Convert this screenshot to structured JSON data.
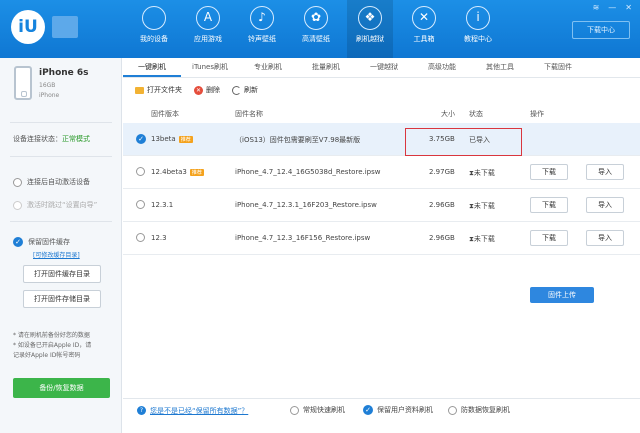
{
  "nav": {
    "items": [
      {
        "label": "我的设备",
        "icon": "apple-icon",
        "glyph": ""
      },
      {
        "label": "应用游戏",
        "icon": "app-store-icon",
        "glyph": "A"
      },
      {
        "label": "铃声壁纸",
        "icon": "bell-icon",
        "glyph": "♪"
      },
      {
        "label": "高清壁纸",
        "icon": "wallpaper-icon",
        "glyph": "✿"
      },
      {
        "label": "刷机越狱",
        "icon": "dropbox-icon",
        "glyph": "❖"
      },
      {
        "label": "工具箱",
        "icon": "toolbox-icon",
        "glyph": "✕"
      },
      {
        "label": "教程中心",
        "icon": "info-icon",
        "glyph": "i"
      }
    ],
    "active_index": 4,
    "download_label": "下载中心"
  },
  "device": {
    "name": "iPhone 6s",
    "capacity": "16GB",
    "model": "iPhone"
  },
  "sidebar": {
    "status_prefix": "设备连接状态：",
    "status_value": "正常模式",
    "option_auto_activate": "连接后自动激活设备",
    "option_skip_setup": "激活时跳过“设置向导”",
    "option_keep_files": "保留固件缓存",
    "link_change": "[可修改缓存目录]",
    "btn_open_cache": "打开固件缓存目录",
    "btn_open_store": "打开固件存储目录",
    "notice_lines": [
      "* 请在刷机前备份好您的数据",
      "* 如设备已开启Apple ID，请",
      "记录好Apple ID帐号密码"
    ],
    "backup_button": "备份/恢复数据"
  },
  "tabs": [
    "一键刷机",
    "iTunes刷机",
    "专业刷机",
    "批量刷机",
    "一键越狱",
    "高级功能",
    "其他工具",
    "下载固件"
  ],
  "toolbar": {
    "open_folder": "打开文件夹",
    "delete": "删除",
    "refresh": "刷新"
  },
  "table": {
    "headers": {
      "version": "固件版本",
      "name": "固件名称",
      "size": "大小",
      "status": "状态",
      "action": "操作"
    },
    "rows": [
      {
        "version": "13beta",
        "tag": "推荐",
        "name": "（iOS13）固件包需要刷至V7.98最新版",
        "size": "3.75GB",
        "status": "已导入",
        "download": "",
        "import": ""
      },
      {
        "version": "12.4beta3",
        "tag": "推荐",
        "name": "iPhone_4.7_12.4_16G5038d_Restore.ipsw",
        "size": "2.97GB",
        "status": "未下载",
        "download": "下载",
        "import": "导入"
      },
      {
        "version": "12.3.1",
        "tag": "",
        "name": "iPhone_4.7_12.3.1_16F203_Restore.ipsw",
        "size": "2.96GB",
        "status": "未下载",
        "download": "下载",
        "import": "导入"
      },
      {
        "version": "12.3",
        "tag": "",
        "name": "iPhone_4.7_12.3_16F156_Restore.ipsw",
        "size": "2.96GB",
        "status": "未下载",
        "download": "下载",
        "import": "导入"
      }
    ]
  },
  "upload_button": "固件上传",
  "bottom": {
    "help_link": "您是不是已经“保留所有数据”？",
    "opt_quick": "常规快速刷机",
    "opt_keep": "保留用户资料刷机",
    "opt_antiflash": "防数据恢复刷机"
  },
  "colors": {
    "brand": "#1684de",
    "ok": "#2a9a2a",
    "warn": "#e08a12",
    "highlight": "#d9363e"
  }
}
